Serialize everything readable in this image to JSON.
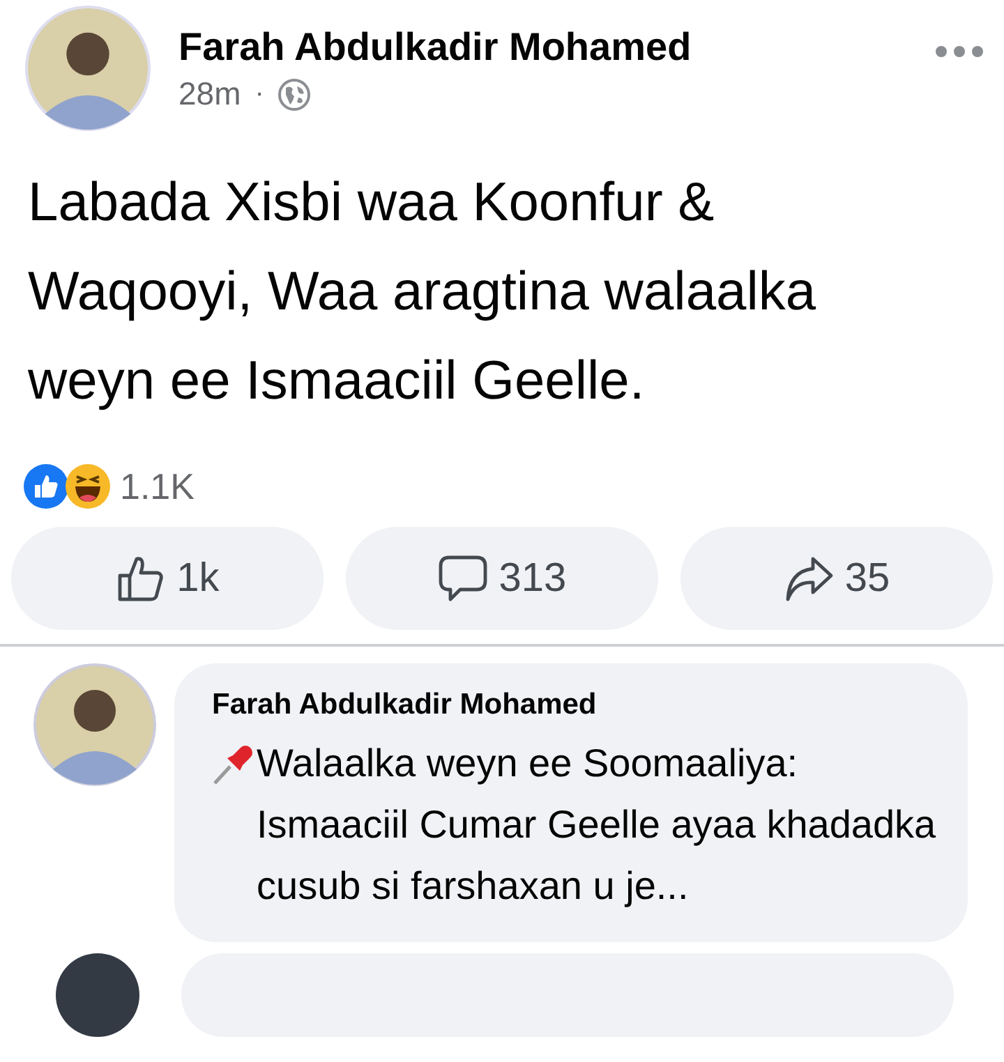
{
  "post": {
    "author": "Farah Abdulkadir Mohamed",
    "time": "28m",
    "separator": "·",
    "text": "Labada Xisbi waa Koonfur & Waqooyi, Waa aragtina walaalka weyn ee Ismaaciil Geelle.",
    "reaction_count": "1.1K",
    "actions": [
      {
        "kind": "like",
        "label": "1k"
      },
      {
        "kind": "comment",
        "label": "313"
      },
      {
        "kind": "share",
        "label": "35"
      }
    ]
  },
  "comment": {
    "author": "Farah Abdulkadir Mohamed",
    "text": "Walaalka weyn ee Soomaaliya: Ismaaciil Cumar Geelle ayaa khadadka cusub si farshaxan u je..."
  }
}
